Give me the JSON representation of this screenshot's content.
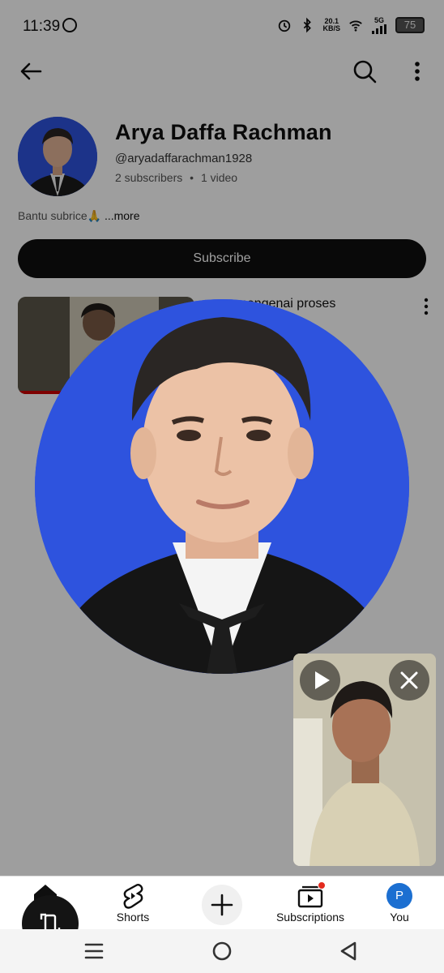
{
  "status_bar": {
    "time": "11:39",
    "net_speed_value": "20.1",
    "net_speed_unit": "KB/S",
    "network": "5G",
    "battery": "75"
  },
  "top_bar": {
    "back_icon": "arrow-left-icon",
    "search_icon": "search-icon",
    "more_icon": "more-vert-icon"
  },
  "channel": {
    "name": "Arya Daffa Rachman",
    "handle": "@aryadaffarachman1928",
    "subscribers": "2 subscribers",
    "separator": "•",
    "videos": "1 video",
    "description": "Bantu subrice🙏",
    "more_label": "...more",
    "subscribe_label": "Subscribe"
  },
  "video": {
    "title": "...an mengenai proses"
  },
  "bottom_nav": {
    "shorts_label": "Shorts",
    "subscriptions_label": "Subscriptions",
    "you_label": "You",
    "you_initial": "P"
  },
  "colors": {
    "avatar_bg": "#2e53de",
    "subscribe_bg": "#0f0f0f",
    "notification_dot": "#e32b1e",
    "you_avatar": "#1c6fd1"
  }
}
